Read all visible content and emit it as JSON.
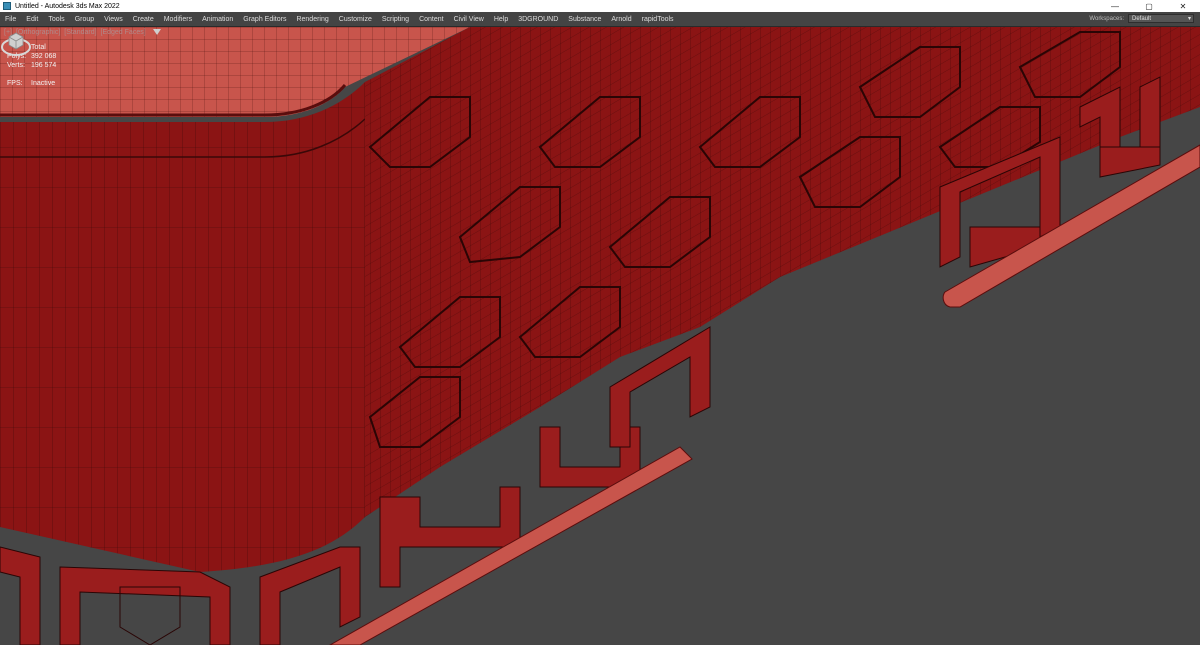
{
  "window": {
    "title": "Untitled - Autodesk 3ds Max 2022",
    "controls": [
      "—",
      "▢",
      "✕"
    ]
  },
  "menubar": {
    "items": [
      "File",
      "Edit",
      "Tools",
      "Group",
      "Views",
      "Create",
      "Modifiers",
      "Animation",
      "Graph Editors",
      "Rendering",
      "Customize",
      "Scripting",
      "Content",
      "Civil View",
      "Help",
      "3DGROUND",
      "Substance",
      "Arnold",
      "rapidTools"
    ],
    "workspaces_label": "Workspaces:",
    "workspaces_value": "Default"
  },
  "viewport": {
    "label": [
      "[+]",
      "[Orthographic]",
      "[Standard]",
      "[Edged Faces]"
    ],
    "stats": {
      "header": "Total",
      "polys_label": "Polys:",
      "polys_value": "392 068",
      "verts_label": "Verts:",
      "verts_value": "196 574",
      "fps_label": "FPS:",
      "fps_value": "Inactive"
    }
  },
  "colors": {
    "mesh_fill": "#8b1414",
    "mesh_light": "#c8514a",
    "wire": "#3a0808",
    "viewport_bg": "#464646"
  }
}
